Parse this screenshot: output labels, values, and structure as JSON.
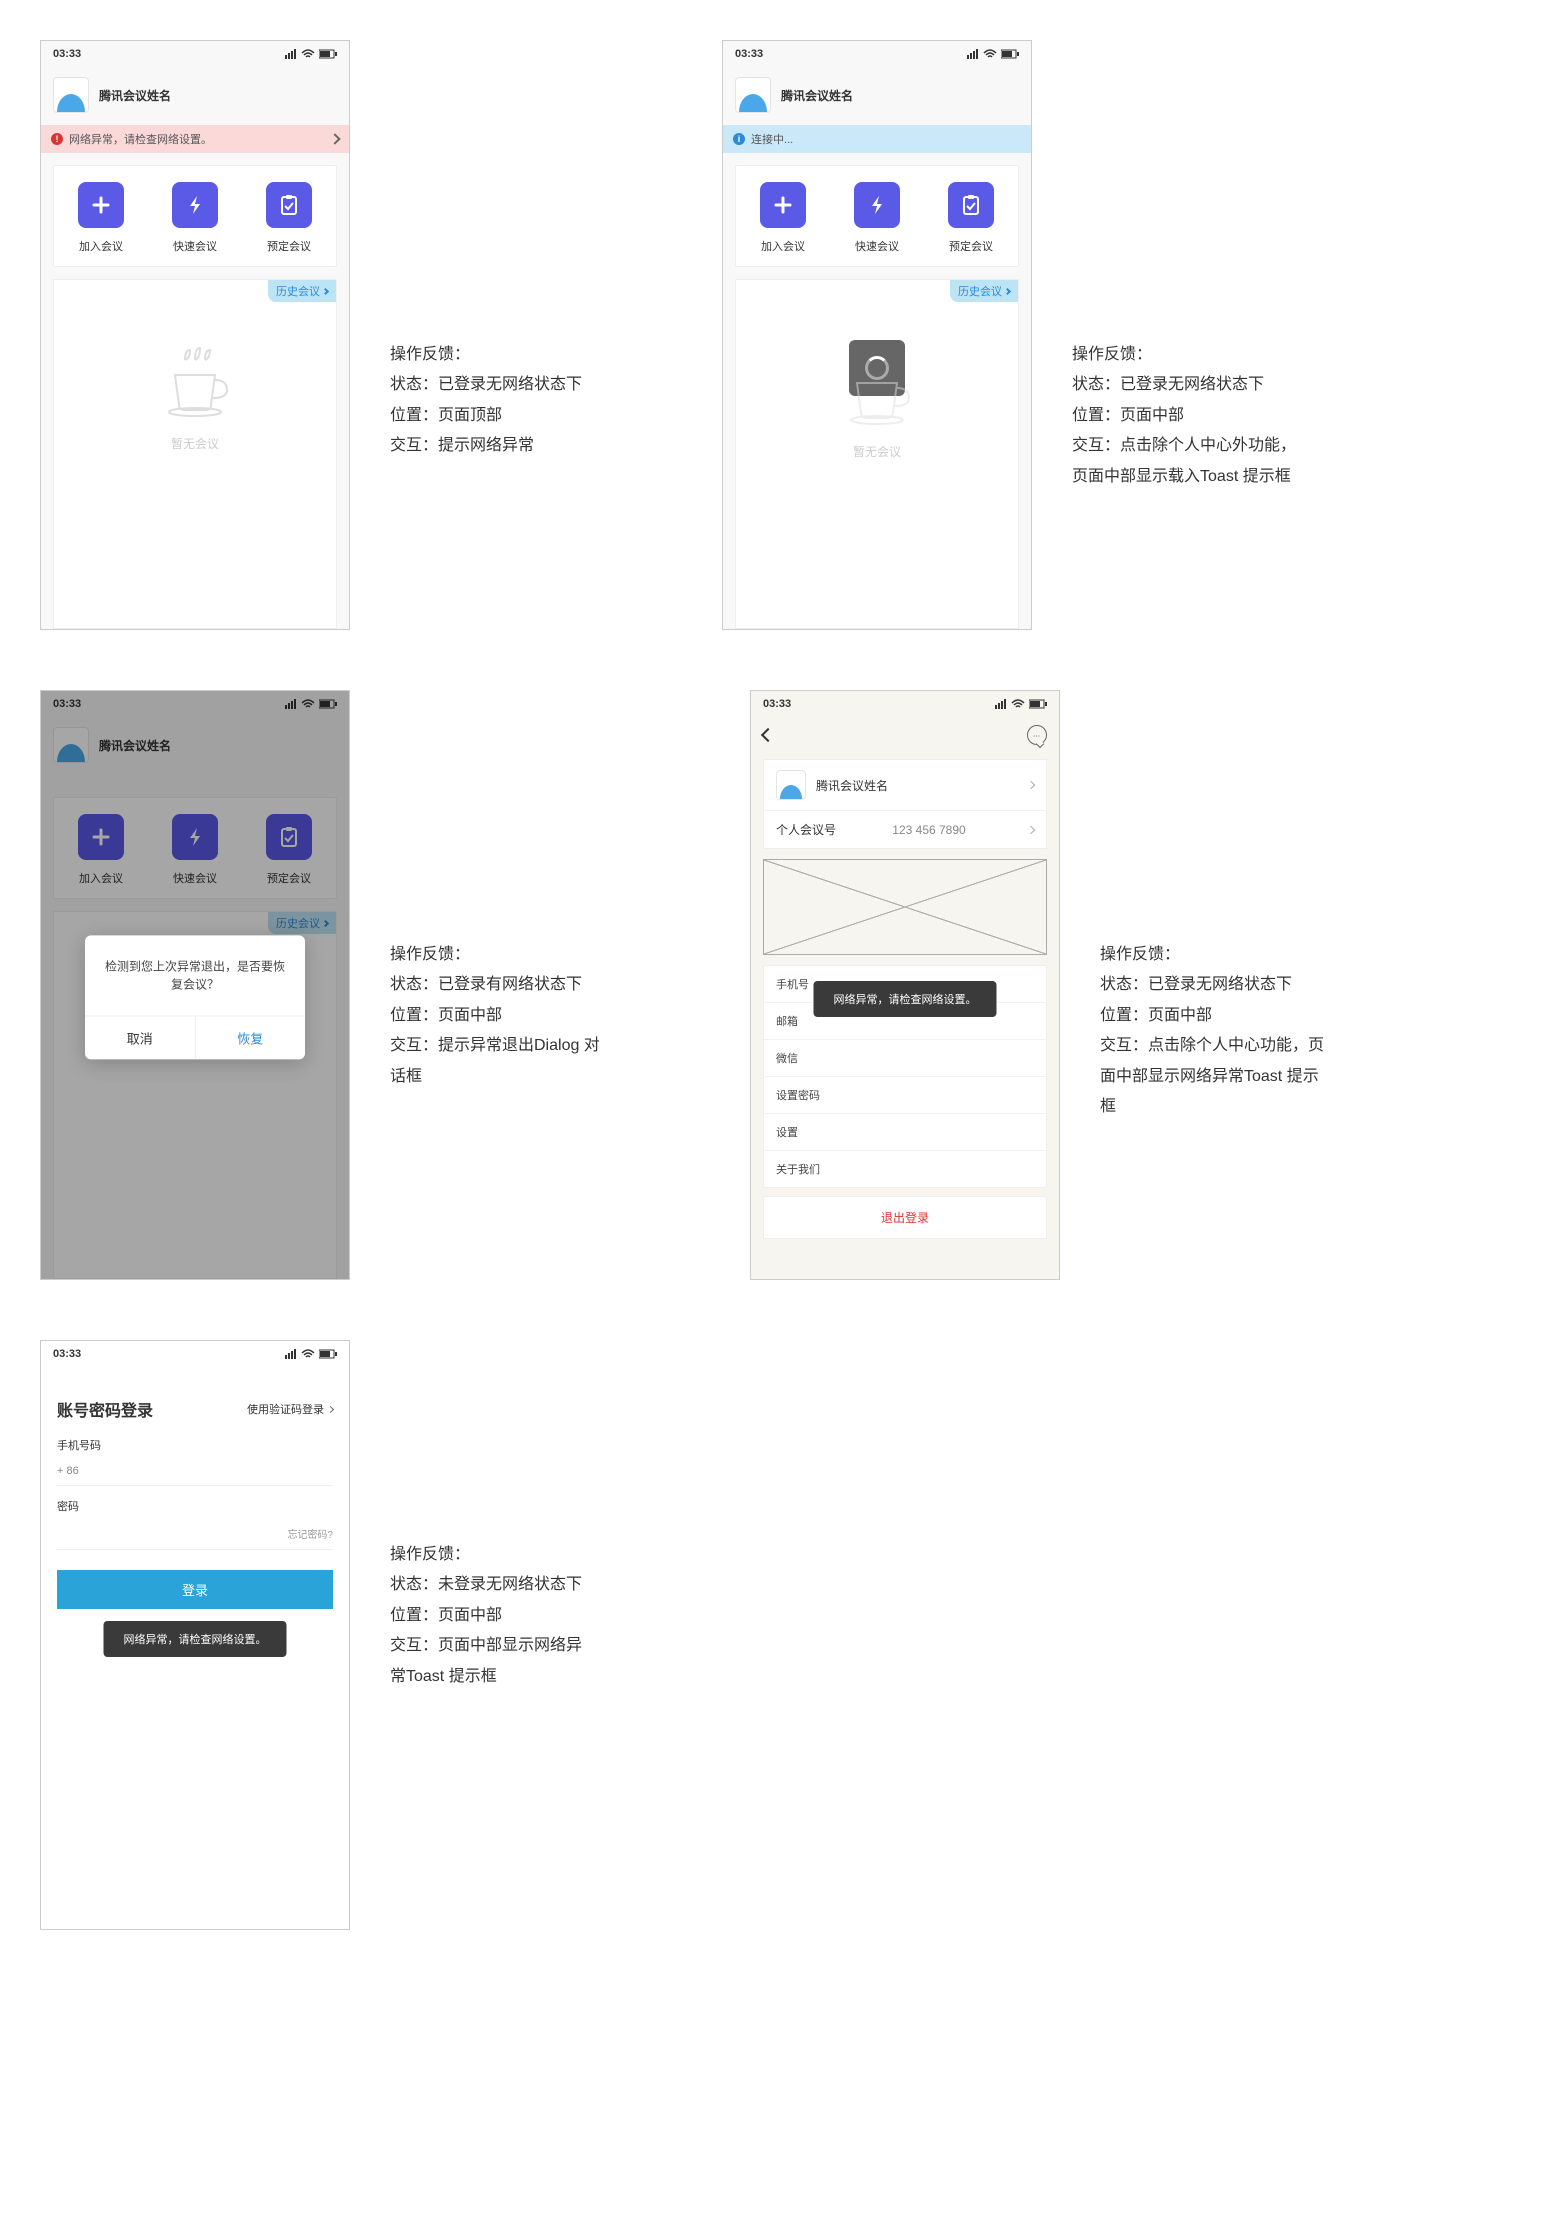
{
  "common": {
    "time": "03:33",
    "username": "腾讯会议姓名",
    "actions": {
      "join": "加入会议",
      "quick": "快速会议",
      "schedule": "预定会议"
    },
    "history_badge": "历史会议",
    "empty_label": "暂无会议",
    "network_error": "网络异常，请检查网络设置。",
    "connecting": "连接中..."
  },
  "screen3": {
    "dialog_msg": "检测到您上次异常退出，是否要恢复会议？",
    "cancel": "取消",
    "restore": "恢复"
  },
  "screen4": {
    "meeting_id_label": "个人会议号",
    "meeting_id_value": "123 456 7890",
    "toast": "网络异常，请检查网络设置。",
    "menu": {
      "phone": "手机号",
      "email": "邮箱",
      "wechat": "微信",
      "setpwd": "设置密码",
      "settings": "设置",
      "about": "关于我们"
    },
    "logout": "退出登录"
  },
  "screen5": {
    "title": "账号密码登录",
    "alt": "使用验证码登录",
    "phone_label": "手机号码",
    "country_code": "+  86",
    "pwd_label": "密码",
    "forgot": "忘记密码?",
    "login_btn": "登录",
    "toast": "网络异常，请检查网络设置。"
  },
  "descriptions": {
    "s1": {
      "title": "操作反馈：",
      "state": "状态：已登录无网络状态下",
      "position": "位置：页面顶部",
      "interaction": "交互：提示网络异常"
    },
    "s2": {
      "title": "操作反馈：",
      "state": "状态：已登录无网络状态下",
      "position": "位置：页面中部",
      "interaction": "交互：点击除个人中心外功能，页面中部显示载入Toast 提示框"
    },
    "s3": {
      "title": "操作反馈：",
      "state": "状态：已登录有网络状态下",
      "position": "位置：页面中部",
      "interaction": "交互：提示异常退出Dialog 对话框"
    },
    "s4": {
      "title": "操作反馈：",
      "state": "状态：已登录无网络状态下",
      "position": "位置：页面中部",
      "interaction": "交互：点击除个人中心功能，页面中部显示网络异常Toast 提示框"
    },
    "s5": {
      "title": "操作反馈：",
      "state": "状态：未登录无网络状态下",
      "position": "位置：页面中部",
      "interaction": "交互：页面中部显示网络异常Toast 提示框"
    }
  }
}
